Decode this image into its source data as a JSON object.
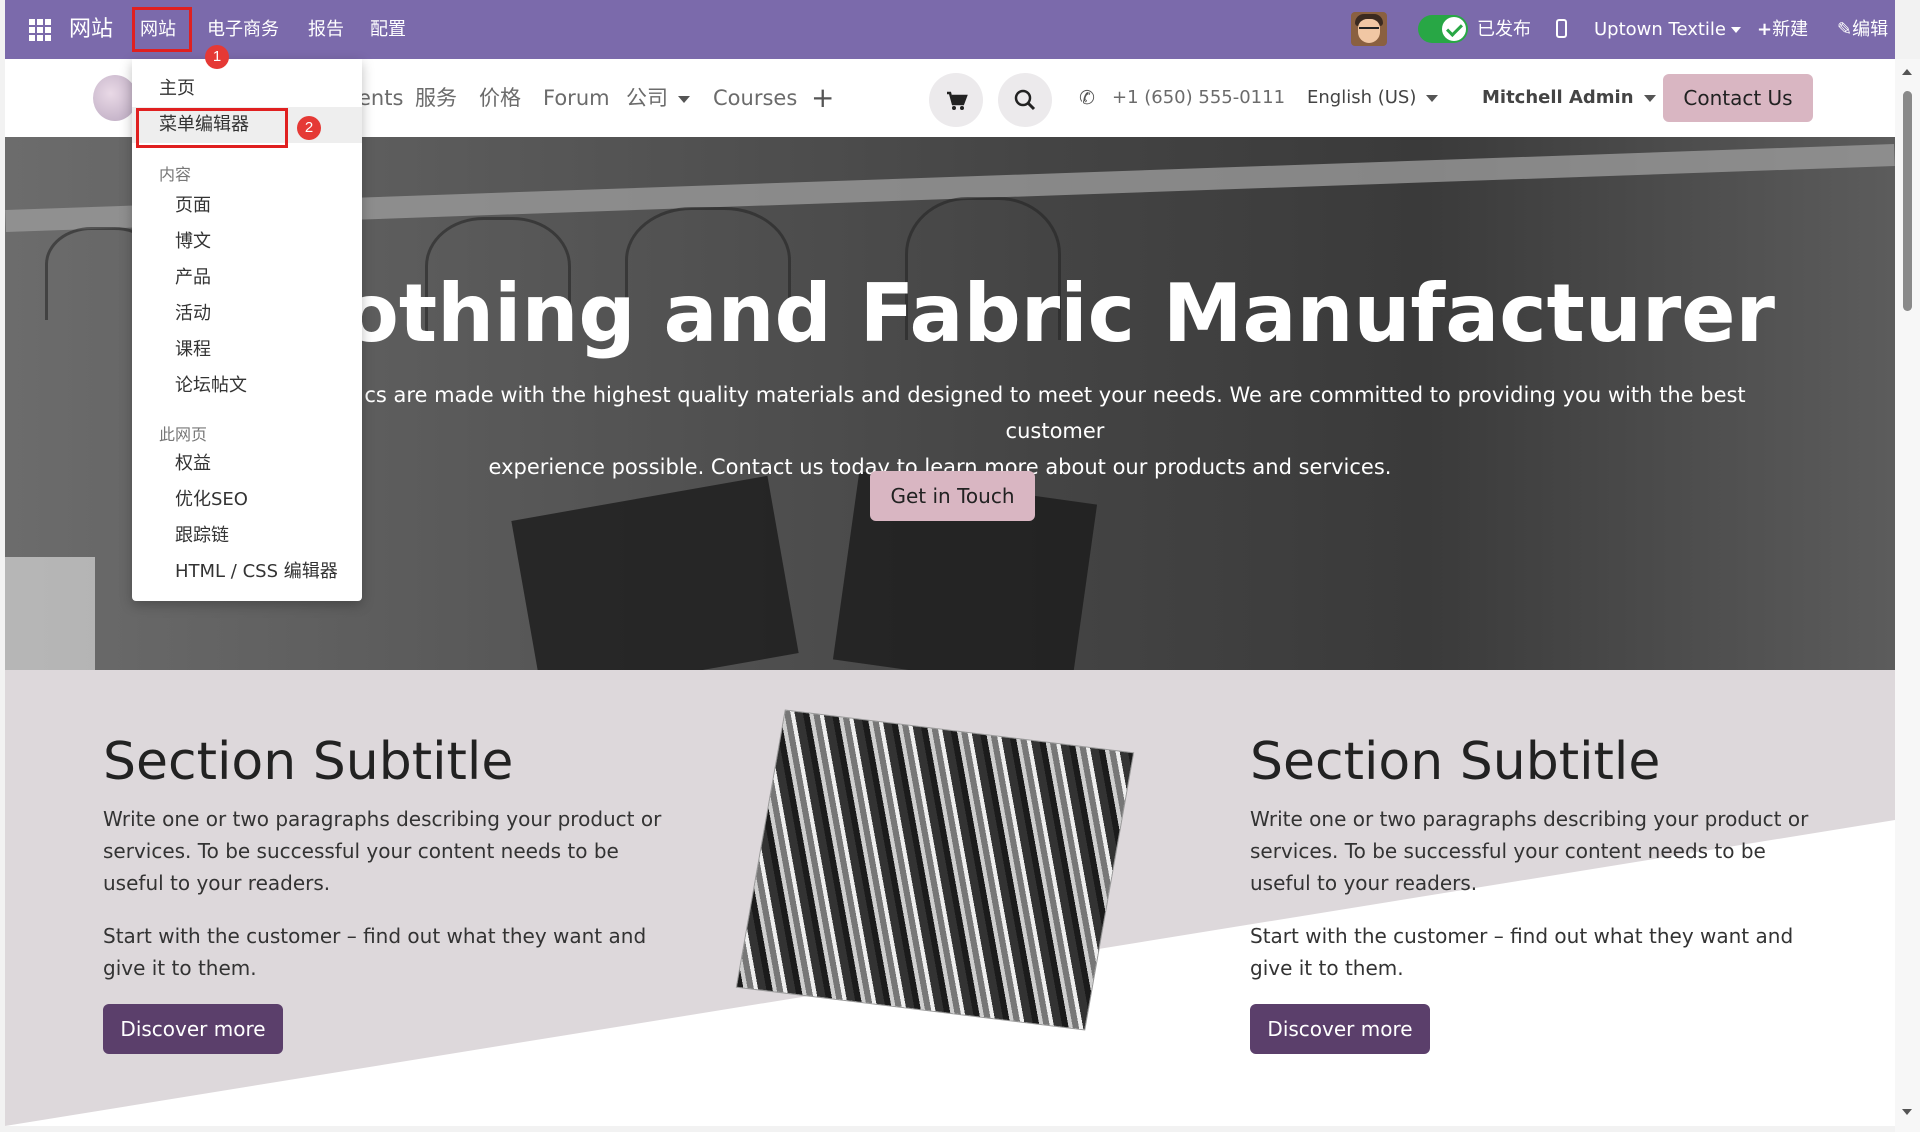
{
  "topbar": {
    "brand": "网站",
    "menus": [
      "网站",
      "电子商务",
      "报告",
      "配置"
    ],
    "published_label": "已发布",
    "company": "Uptown Textile",
    "new_label": "新建",
    "edit_label": "编辑",
    "annotations": {
      "step1": "1",
      "step2": "2"
    },
    "bg_color": "#7b6aab"
  },
  "site_nav": {
    "items": [
      "ents",
      "服务",
      "价格",
      "Forum",
      "公司",
      "Courses"
    ],
    "phone": "+1 (650) 555-0111",
    "language": "English (US)",
    "user": "Mitchell Admin",
    "contact_button": "Contact Us"
  },
  "dropdown": {
    "home": "主页",
    "menu_editor": "菜单编辑器",
    "content_header": "内容",
    "content_items": [
      "页面",
      "博文",
      "产品",
      "活动",
      "课程",
      "论坛帖文"
    ],
    "page_header": "此网页",
    "page_items": [
      "权益",
      "优化SEO",
      "跟踪链",
      "HTML / CSS 编辑器"
    ]
  },
  "hero": {
    "title": "h Clothing and Fabric Manufacturer",
    "description_line1": "cs are made with the highest quality materials and designed to meet your needs. We are committed to providing you with the best customer",
    "description_line2": "experience possible. Contact us today to learn more about our products and services.",
    "button": "Get in Touch"
  },
  "sections": [
    {
      "title": "Section Subtitle",
      "p1": "Write one or two paragraphs describing your product or services. To be successful your content needs to be useful to your readers.",
      "p2": "Start with the customer – find out what they want and give it to them.",
      "button": "Discover more"
    },
    {
      "title": "Section Subtitle",
      "p1": "Write one or two paragraphs describing your product or services. To be successful your content needs to be useful to your readers.",
      "p2": "Start with the customer – find out what they want and give it to them.",
      "button": "Discover more"
    }
  ],
  "colors": {
    "accent_pink": "#d9b6c2",
    "button_purple": "#5b3f6b",
    "highlight_red": "#e02020",
    "toggle_green": "#28a745"
  }
}
